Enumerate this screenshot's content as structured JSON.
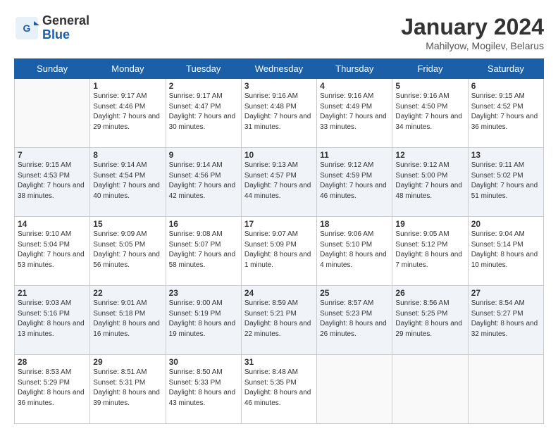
{
  "header": {
    "logo_general": "General",
    "logo_blue": "Blue",
    "month": "January 2024",
    "location": "Mahilyow, Mogilev, Belarus"
  },
  "days_of_week": [
    "Sunday",
    "Monday",
    "Tuesday",
    "Wednesday",
    "Thursday",
    "Friday",
    "Saturday"
  ],
  "weeks": [
    [
      {
        "day": "",
        "sunrise": "",
        "sunset": "",
        "daylight": ""
      },
      {
        "day": "1",
        "sunrise": "Sunrise: 9:17 AM",
        "sunset": "Sunset: 4:46 PM",
        "daylight": "Daylight: 7 hours and 29 minutes."
      },
      {
        "day": "2",
        "sunrise": "Sunrise: 9:17 AM",
        "sunset": "Sunset: 4:47 PM",
        "daylight": "Daylight: 7 hours and 30 minutes."
      },
      {
        "day": "3",
        "sunrise": "Sunrise: 9:16 AM",
        "sunset": "Sunset: 4:48 PM",
        "daylight": "Daylight: 7 hours and 31 minutes."
      },
      {
        "day": "4",
        "sunrise": "Sunrise: 9:16 AM",
        "sunset": "Sunset: 4:49 PM",
        "daylight": "Daylight: 7 hours and 33 minutes."
      },
      {
        "day": "5",
        "sunrise": "Sunrise: 9:16 AM",
        "sunset": "Sunset: 4:50 PM",
        "daylight": "Daylight: 7 hours and 34 minutes."
      },
      {
        "day": "6",
        "sunrise": "Sunrise: 9:15 AM",
        "sunset": "Sunset: 4:52 PM",
        "daylight": "Daylight: 7 hours and 36 minutes."
      }
    ],
    [
      {
        "day": "7",
        "sunrise": "Sunrise: 9:15 AM",
        "sunset": "Sunset: 4:53 PM",
        "daylight": "Daylight: 7 hours and 38 minutes."
      },
      {
        "day": "8",
        "sunrise": "Sunrise: 9:14 AM",
        "sunset": "Sunset: 4:54 PM",
        "daylight": "Daylight: 7 hours and 40 minutes."
      },
      {
        "day": "9",
        "sunrise": "Sunrise: 9:14 AM",
        "sunset": "Sunset: 4:56 PM",
        "daylight": "Daylight: 7 hours and 42 minutes."
      },
      {
        "day": "10",
        "sunrise": "Sunrise: 9:13 AM",
        "sunset": "Sunset: 4:57 PM",
        "daylight": "Daylight: 7 hours and 44 minutes."
      },
      {
        "day": "11",
        "sunrise": "Sunrise: 9:12 AM",
        "sunset": "Sunset: 4:59 PM",
        "daylight": "Daylight: 7 hours and 46 minutes."
      },
      {
        "day": "12",
        "sunrise": "Sunrise: 9:12 AM",
        "sunset": "Sunset: 5:00 PM",
        "daylight": "Daylight: 7 hours and 48 minutes."
      },
      {
        "day": "13",
        "sunrise": "Sunrise: 9:11 AM",
        "sunset": "Sunset: 5:02 PM",
        "daylight": "Daylight: 7 hours and 51 minutes."
      }
    ],
    [
      {
        "day": "14",
        "sunrise": "Sunrise: 9:10 AM",
        "sunset": "Sunset: 5:04 PM",
        "daylight": "Daylight: 7 hours and 53 minutes."
      },
      {
        "day": "15",
        "sunrise": "Sunrise: 9:09 AM",
        "sunset": "Sunset: 5:05 PM",
        "daylight": "Daylight: 7 hours and 56 minutes."
      },
      {
        "day": "16",
        "sunrise": "Sunrise: 9:08 AM",
        "sunset": "Sunset: 5:07 PM",
        "daylight": "Daylight: 7 hours and 58 minutes."
      },
      {
        "day": "17",
        "sunrise": "Sunrise: 9:07 AM",
        "sunset": "Sunset: 5:09 PM",
        "daylight": "Daylight: 8 hours and 1 minute."
      },
      {
        "day": "18",
        "sunrise": "Sunrise: 9:06 AM",
        "sunset": "Sunset: 5:10 PM",
        "daylight": "Daylight: 8 hours and 4 minutes."
      },
      {
        "day": "19",
        "sunrise": "Sunrise: 9:05 AM",
        "sunset": "Sunset: 5:12 PM",
        "daylight": "Daylight: 8 hours and 7 minutes."
      },
      {
        "day": "20",
        "sunrise": "Sunrise: 9:04 AM",
        "sunset": "Sunset: 5:14 PM",
        "daylight": "Daylight: 8 hours and 10 minutes."
      }
    ],
    [
      {
        "day": "21",
        "sunrise": "Sunrise: 9:03 AM",
        "sunset": "Sunset: 5:16 PM",
        "daylight": "Daylight: 8 hours and 13 minutes."
      },
      {
        "day": "22",
        "sunrise": "Sunrise: 9:01 AM",
        "sunset": "Sunset: 5:18 PM",
        "daylight": "Daylight: 8 hours and 16 minutes."
      },
      {
        "day": "23",
        "sunrise": "Sunrise: 9:00 AM",
        "sunset": "Sunset: 5:19 PM",
        "daylight": "Daylight: 8 hours and 19 minutes."
      },
      {
        "day": "24",
        "sunrise": "Sunrise: 8:59 AM",
        "sunset": "Sunset: 5:21 PM",
        "daylight": "Daylight: 8 hours and 22 minutes."
      },
      {
        "day": "25",
        "sunrise": "Sunrise: 8:57 AM",
        "sunset": "Sunset: 5:23 PM",
        "daylight": "Daylight: 8 hours and 26 minutes."
      },
      {
        "day": "26",
        "sunrise": "Sunrise: 8:56 AM",
        "sunset": "Sunset: 5:25 PM",
        "daylight": "Daylight: 8 hours and 29 minutes."
      },
      {
        "day": "27",
        "sunrise": "Sunrise: 8:54 AM",
        "sunset": "Sunset: 5:27 PM",
        "daylight": "Daylight: 8 hours and 32 minutes."
      }
    ],
    [
      {
        "day": "28",
        "sunrise": "Sunrise: 8:53 AM",
        "sunset": "Sunset: 5:29 PM",
        "daylight": "Daylight: 8 hours and 36 minutes."
      },
      {
        "day": "29",
        "sunrise": "Sunrise: 8:51 AM",
        "sunset": "Sunset: 5:31 PM",
        "daylight": "Daylight: 8 hours and 39 minutes."
      },
      {
        "day": "30",
        "sunrise": "Sunrise: 8:50 AM",
        "sunset": "Sunset: 5:33 PM",
        "daylight": "Daylight: 8 hours and 43 minutes."
      },
      {
        "day": "31",
        "sunrise": "Sunrise: 8:48 AM",
        "sunset": "Sunset: 5:35 PM",
        "daylight": "Daylight: 8 hours and 46 minutes."
      },
      {
        "day": "",
        "sunrise": "",
        "sunset": "",
        "daylight": ""
      },
      {
        "day": "",
        "sunrise": "",
        "sunset": "",
        "daylight": ""
      },
      {
        "day": "",
        "sunrise": "",
        "sunset": "",
        "daylight": ""
      }
    ]
  ]
}
